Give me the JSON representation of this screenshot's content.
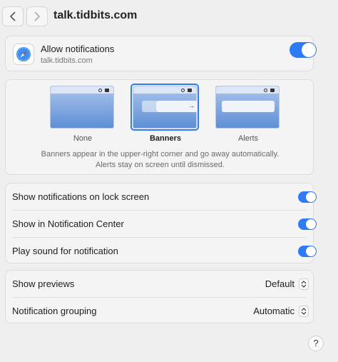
{
  "header": {
    "title": "talk.tidbits.com"
  },
  "allow": {
    "label": "Allow notifications",
    "site": "talk.tidbits.com",
    "enabled": true
  },
  "styles": {
    "options": [
      {
        "label": "None",
        "selected": false
      },
      {
        "label": "Banners",
        "selected": true
      },
      {
        "label": "Alerts",
        "selected": false
      }
    ],
    "description_line1": "Banners appear in the upper-right corner and go away automatically.",
    "description_line2": "Alerts stay on screen until dismissed."
  },
  "toggles": [
    {
      "label": "Show notifications on lock screen",
      "on": true
    },
    {
      "label": "Show in Notification Center",
      "on": true
    },
    {
      "label": "Play sound for notification",
      "on": true
    }
  ],
  "selects": [
    {
      "label": "Show previews",
      "value": "Default"
    },
    {
      "label": "Notification grouping",
      "value": "Automatic"
    }
  ],
  "help": {
    "label": "?"
  },
  "colors": {
    "accent": "#2f7bf5"
  },
  "icons": {
    "back": "chevron-left-icon",
    "forward": "chevron-right-icon",
    "app": "safari-compass-icon",
    "stepper": "up-down-chevron-icon"
  }
}
